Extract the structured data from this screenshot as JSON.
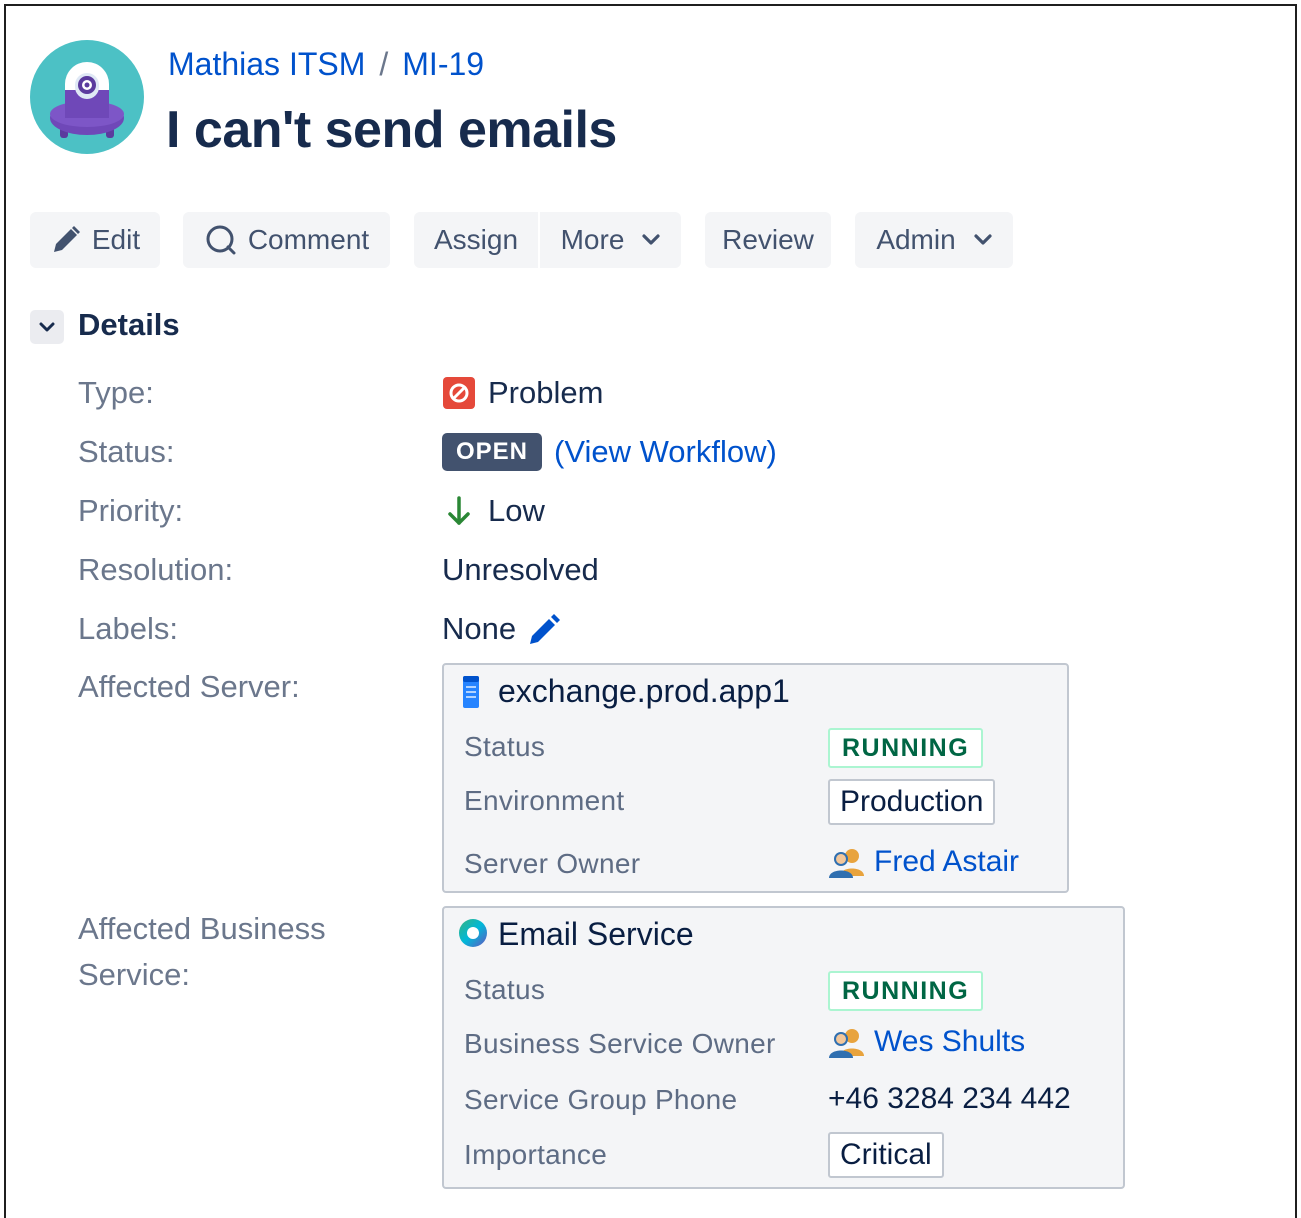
{
  "breadcrumb": {
    "project": "Mathias ITSM",
    "separator": "/",
    "issue_key": "MI-19"
  },
  "issue": {
    "title": "I can't send emails"
  },
  "toolbar": {
    "edit": "Edit",
    "comment": "Comment",
    "assign": "Assign",
    "more": "More",
    "review": "Review",
    "admin": "Admin"
  },
  "details": {
    "heading": "Details",
    "type_label": "Type:",
    "type_value": "Problem",
    "status_label": "Status:",
    "status_value": "OPEN",
    "workflow_open": "(",
    "workflow_link": "View Workflow",
    "workflow_close": ")",
    "priority_label": "Priority:",
    "priority_value": "Low",
    "resolution_label": "Resolution:",
    "resolution_value": "Unresolved",
    "labels_label": "Labels:",
    "labels_value": "None",
    "server_label": "Affected Server:",
    "service_label_line1": "Affected Business",
    "service_label_line2": "Service:"
  },
  "server_card": {
    "name": "exchange.prod.app1",
    "status_label": "Status",
    "status_value": "RUNNING",
    "env_label": "Environment",
    "env_value": "Production",
    "owner_label": "Server Owner",
    "owner_value": "Fred Astair"
  },
  "service_card": {
    "name": "Email Service",
    "status_label": "Status",
    "status_value": "RUNNING",
    "owner_label": "Business Service Owner",
    "owner_value": "Wes Shults",
    "phone_label": "Service Group Phone",
    "phone_value": "+46 3284 234 442",
    "importance_label": "Importance",
    "importance_value": "Critical"
  },
  "colors": {
    "link": "#0052cc",
    "text": "#172b4d",
    "muted": "#6b778c",
    "problem": "#e5493a",
    "priority_low": "#2a8735",
    "running": "#006644"
  }
}
